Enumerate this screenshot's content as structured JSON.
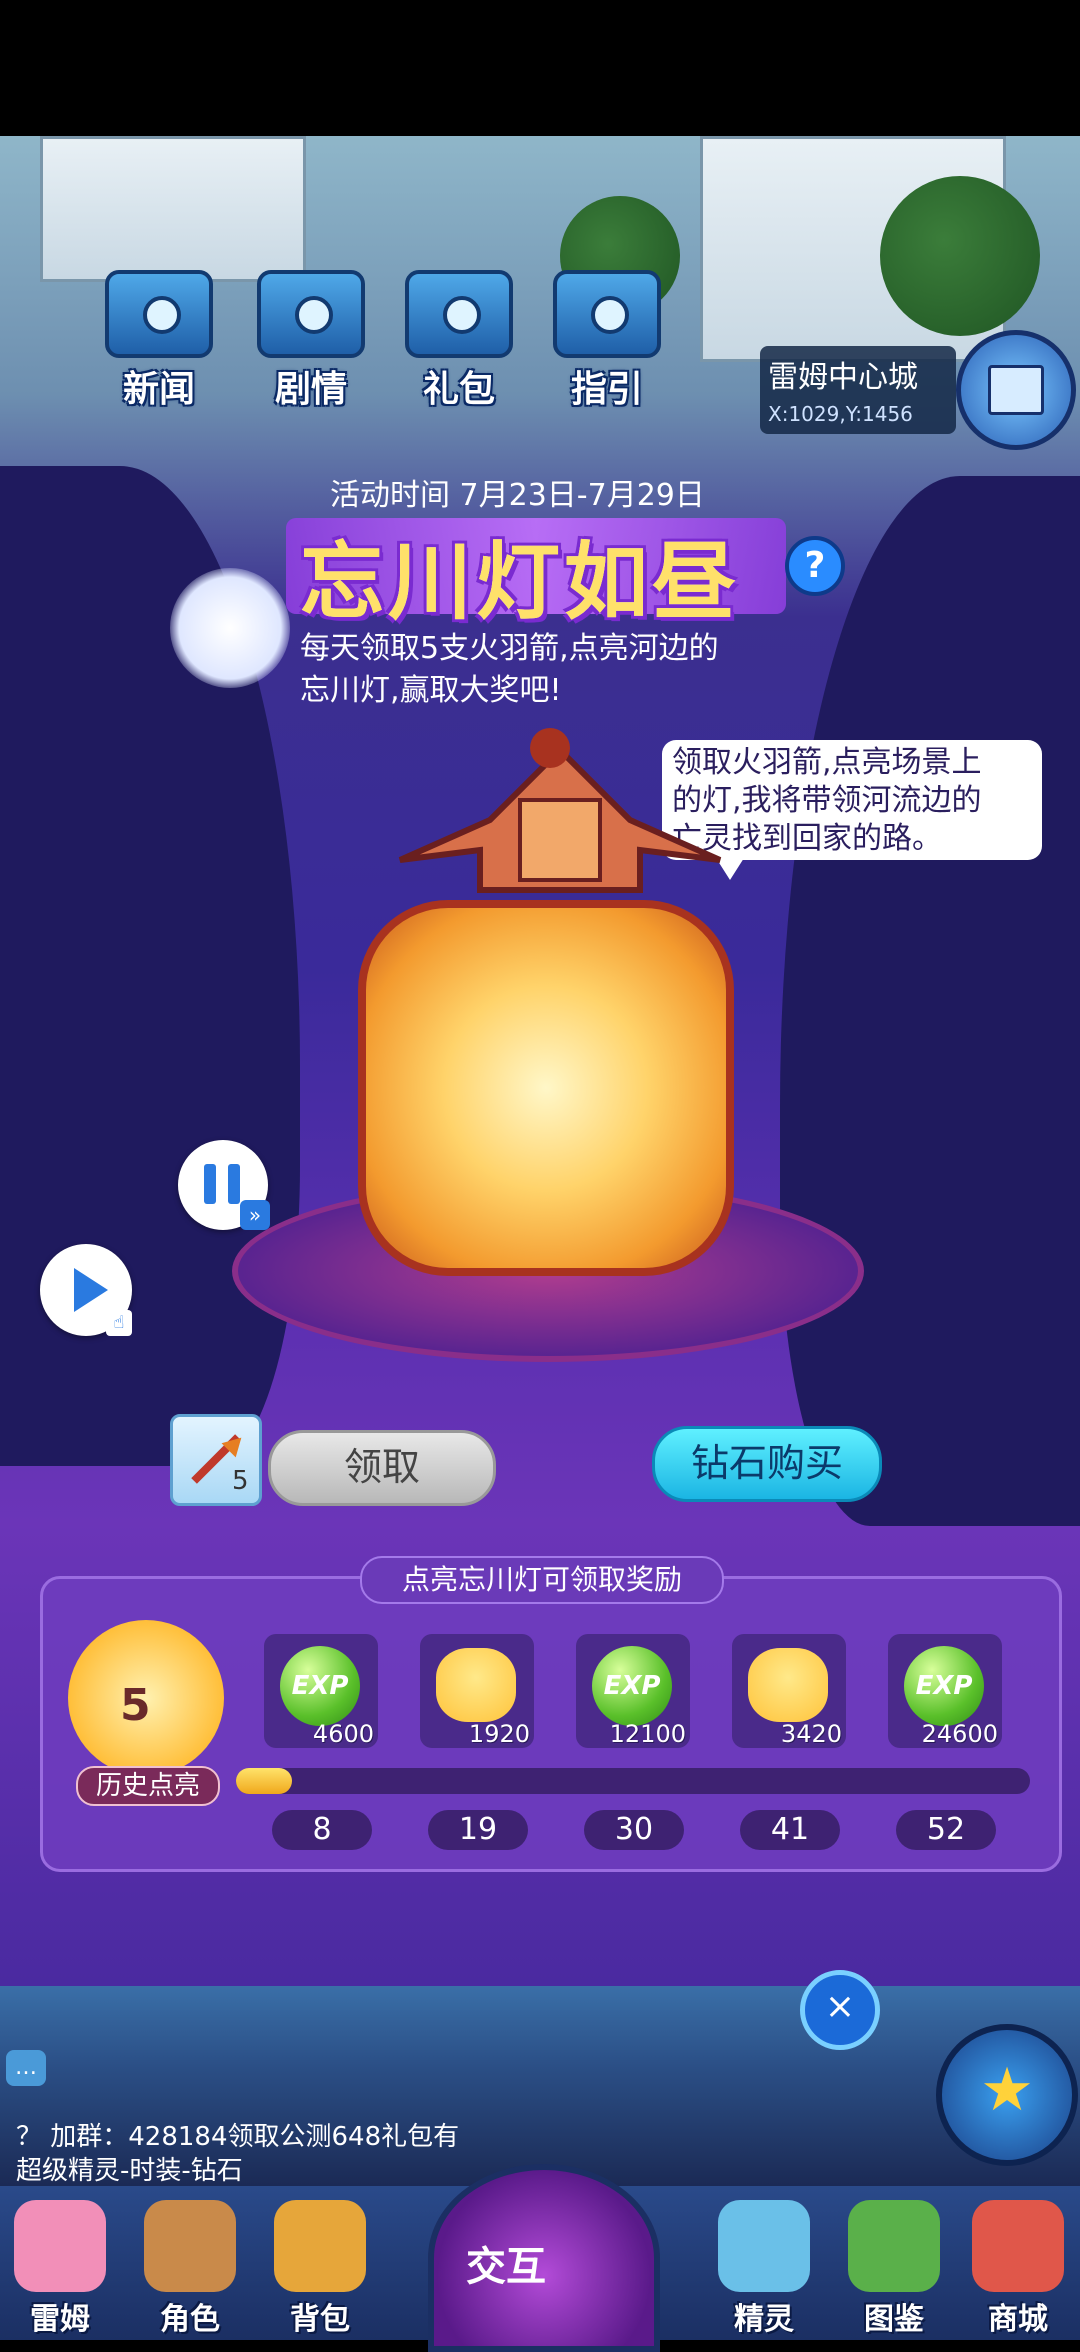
{
  "top_buttons": [
    {
      "label": "新闻",
      "icon": "news-icon"
    },
    {
      "label": "剧情",
      "icon": "story-icon"
    },
    {
      "label": "礼包",
      "icon": "gift-icon"
    },
    {
      "label": "指引",
      "icon": "guide-icon"
    }
  ],
  "location": {
    "name": "雷姆中心城",
    "coords": "X:1029,Y:1456"
  },
  "event": {
    "time": "活动时间 7月23日-7月29日",
    "title": "忘川灯如昼",
    "desc_line1": "每天领取5支火羽箭,点亮河边的",
    "desc_line2": "忘川灯,赢取大奖吧!",
    "speech_line1": "领取火羽箭,点亮场景上",
    "speech_line2": "的灯,我将带领河流边的",
    "speech_line3": "亡灵找到回家的路。",
    "arrow_count": "5",
    "claim_label": "领取",
    "buy_label": "钻石购买"
  },
  "rewards": {
    "header": "点亮忘川灯可领取奖励",
    "history_count": "5",
    "history_label": "历史点亮",
    "progress": 0.07,
    "items": [
      {
        "type": "exp",
        "icon_text": "EXP",
        "amount": "4600",
        "milestone": "8"
      },
      {
        "type": "cat",
        "icon_text": "",
        "amount": "1920",
        "milestone": "19"
      },
      {
        "type": "exp",
        "icon_text": "EXP",
        "amount": "12100",
        "milestone": "30"
      },
      {
        "type": "cat",
        "icon_text": "",
        "amount": "3420",
        "milestone": "41"
      },
      {
        "type": "exp",
        "icon_text": "EXP",
        "amount": "24600",
        "milestone": "52"
      }
    ]
  },
  "chat": {
    "icon_text": "…",
    "line1": "？ 加群：428184领取公测648礼包有",
    "line2": "超级精灵-时装-钻石"
  },
  "close_symbol": "×",
  "bottom_nav": {
    "items": [
      {
        "label": "雷姆",
        "color": "#f28fb8"
      },
      {
        "label": "角色",
        "color": "#c98a4a"
      },
      {
        "label": "背包",
        "color": "#e6a63a"
      },
      {
        "label": "精灵",
        "color": "#6ac0e8"
      },
      {
        "label": "图鉴",
        "color": "#5ab04a"
      },
      {
        "label": "商城",
        "color": "#e0574a"
      }
    ],
    "center_label": "交互"
  }
}
